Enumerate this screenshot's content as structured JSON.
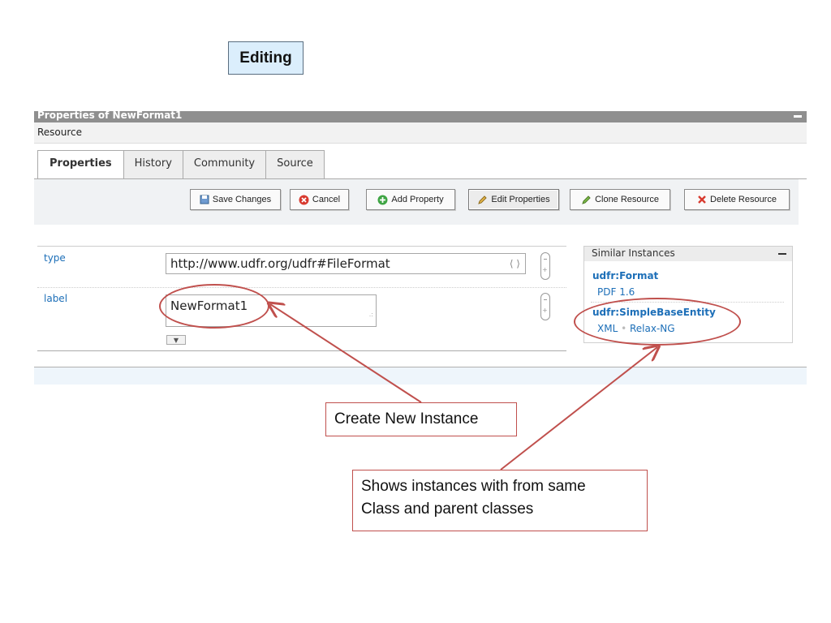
{
  "slide": {
    "title": "Editing"
  },
  "window": {
    "title": "Properties of NewFormat1",
    "menu": "Resource",
    "tabs": [
      "Properties",
      "History",
      "Community",
      "Source"
    ],
    "active_tab": "Properties"
  },
  "toolbar": {
    "save": "Save Changes",
    "cancel": "Cancel",
    "add_property": "Add Property",
    "edit_properties": "Edit Properties",
    "clone": "Clone Resource",
    "delete": "Delete Resource"
  },
  "properties": {
    "type_label": "type",
    "type_value": "http://www.udfr.org/udfr#FileFormat",
    "label_label": "label",
    "label_value": "NewFormat1"
  },
  "similar": {
    "title": "Similar Instances",
    "class1": "udfr:Format",
    "class1_item": "PDF 1.6",
    "class2": "udfr:SimpleBaseEntity",
    "class2_items": [
      "XML",
      "Relax-NG"
    ]
  },
  "annotations": {
    "create": "Create New Instance",
    "shows_line1": "Shows instances with from same",
    "shows_line2": "Class and parent classes"
  },
  "colors": {
    "annotation": "#c0504d",
    "link": "#1d6fb8",
    "title_bg": "#dbeefc"
  }
}
